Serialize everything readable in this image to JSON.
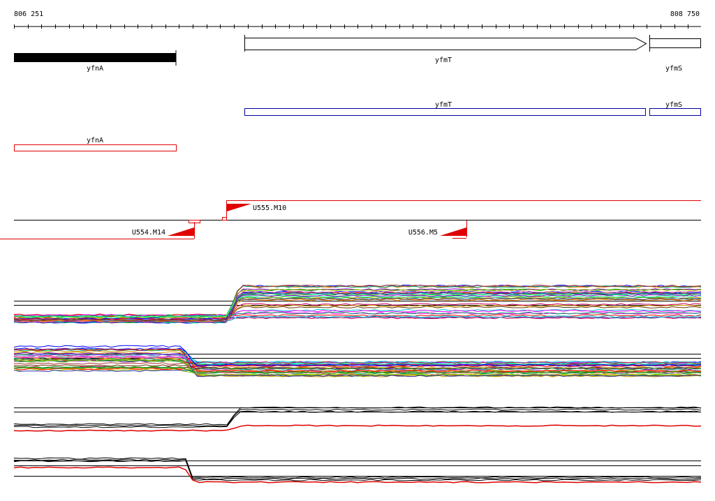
{
  "ruler": {
    "start_label": "806 251",
    "end_label": "808 750"
  },
  "genes": {
    "track1": [
      {
        "name": "yfnA",
        "style": "solid-black"
      },
      {
        "name": "yfmT",
        "style": "arrow-outline"
      },
      {
        "name": "yfmS",
        "style": "outline"
      }
    ],
    "track2": [
      {
        "name": "yfmT",
        "color": "#0000a0"
      },
      {
        "name": "yfmS",
        "color": "#0000a0"
      }
    ],
    "track3": [
      {
        "name": "yfnA",
        "color": "#e00000"
      }
    ]
  },
  "features": [
    {
      "name": "U555.M10",
      "strand": "+",
      "color": "#e00000"
    },
    {
      "name": "U554.M14",
      "strand": "-",
      "color": "#e00000"
    },
    {
      "name": "U556.M5",
      "strand": "-",
      "color": "#e00000"
    }
  ],
  "colors": {
    "forward": "#e00000",
    "gene_outline": "#0000a0",
    "text": "#000000"
  }
}
